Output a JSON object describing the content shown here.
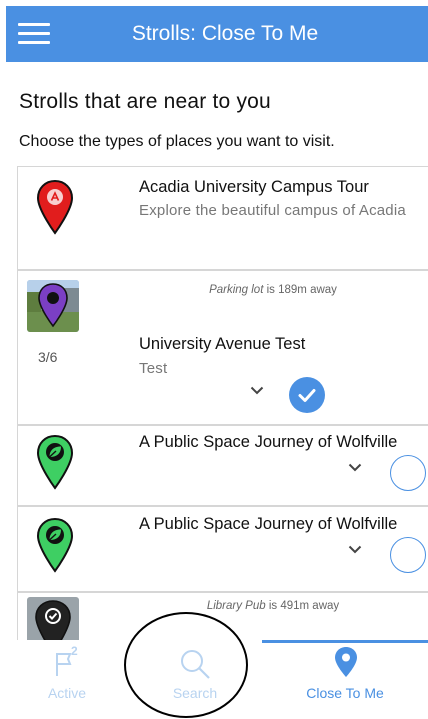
{
  "header": {
    "title": "Strolls: Close To Me",
    "menu_icon": "hamburger-menu-icon",
    "background": "#4a90e2"
  },
  "main": {
    "heading": "Strolls that are near to you",
    "subheading": "Choose the types of places you want to visit."
  },
  "strolls": [
    {
      "title": "Acadia University Campus Tour",
      "description": "Explore the beautiful campus of Acadia",
      "pin_color": "#e11d1d",
      "pin_icon": "location-pin-icon"
    },
    {
      "distance_place": "Parking lot",
      "distance_text": " is 189m away",
      "progress": "3/6",
      "title": "University Avenue Test",
      "description": "Test",
      "pin_color": "#7b3fc4",
      "selected": true
    },
    {
      "title": "A Public Space Journey of Wolfville",
      "pin_color": "#3ecf63",
      "pin_icon": "leaf-icon",
      "selected": false
    },
    {
      "title": "A Public Space Journey of Wolfville",
      "pin_color": "#3ecf63",
      "pin_icon": "leaf-icon",
      "selected": false
    },
    {
      "distance_place": "Library Pub",
      "distance_text": " is 491m away",
      "pin_color": "#222222"
    }
  ],
  "bottom_nav": {
    "tabs": [
      {
        "label": "Active",
        "icon": "flag-icon",
        "badge": "2",
        "active": false
      },
      {
        "label": "Search",
        "icon": "search-icon",
        "active": false
      },
      {
        "label": "Close To Me",
        "icon": "location-pin-icon",
        "active": true
      }
    ],
    "active_color": "#4a90e2",
    "inactive_color": "#b8d3f0"
  }
}
